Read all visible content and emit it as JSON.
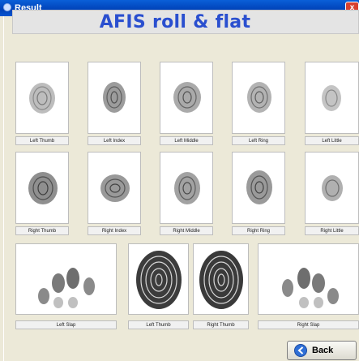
{
  "window": {
    "title": "Result",
    "close_glyph": "x"
  },
  "header": {
    "title": "AFIS roll & flat"
  },
  "rows": {
    "left": [
      "Left Thumb",
      "Left Index",
      "Left Middle",
      "Left Ring",
      "Left Little"
    ],
    "right": [
      "Right Thumb",
      "Right Index",
      "Right Middle",
      "Right Ring",
      "Right Little"
    ]
  },
  "slaps": [
    "Left Slap",
    "Left Thumb",
    "Right Thumb",
    "Right Slap"
  ],
  "buttons": {
    "back": "Back"
  },
  "icons": {
    "back": "back-arrow-icon",
    "app": "app-icon",
    "close": "close-icon"
  },
  "colors": {
    "title_blue": "#2a4fcf",
    "titlebar": "#0a56d0"
  }
}
